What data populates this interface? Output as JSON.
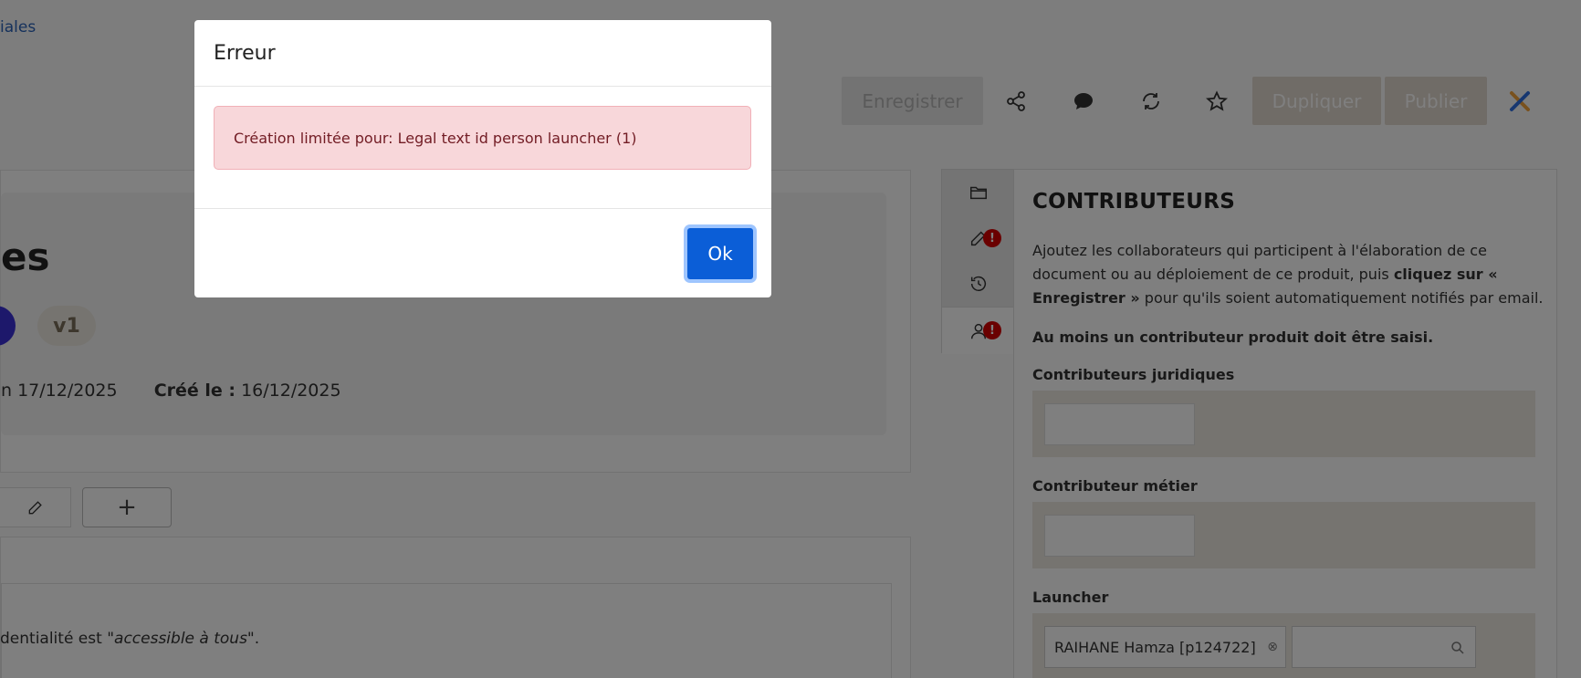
{
  "breadcrumb": {
    "fragment": "iales"
  },
  "toolbar": {
    "save_label": "Enregistrer",
    "duplicate_label": "Dupliquer",
    "publish_label": "Publier"
  },
  "card": {
    "title_fragment": "es",
    "version_badge": "v1",
    "modified_fragment": "n 17/12/2025",
    "created_label": "Créé le :",
    "created_value": "16/12/2025"
  },
  "tabs": {
    "add_label": "+"
  },
  "content": {
    "confidentiality_prefix": "dentialité est ",
    "confidentiality_value": "\"accessible à tous\"",
    "confidentiality_suffix": "."
  },
  "right_panel": {
    "title": "CONTRIBUTEURS",
    "desc_part1": "Ajoutez les collaborateurs qui participent à l'élaboration de ce document ou au déploiement de ce produit, puis ",
    "desc_bold": "cliquez sur « Enregistrer »",
    "desc_part2": " pour qu'ils soient automatiquement notifiés par email.",
    "requirement": "Au moins un contributeur produit doit être saisi.",
    "section_legal": "Contributeurs juridiques",
    "section_business": "Contributeur métier",
    "section_launcher": "Launcher",
    "launcher_tag": "RAIHANE Hamza [p124722]"
  },
  "modal": {
    "title": "Erreur",
    "message": "Création limitée pour: Legal text id person launcher (1)",
    "ok_label": "Ok"
  },
  "colors": {
    "primary": "#0b5ed7",
    "danger_bg": "#f8d7da",
    "danger_text": "#721c24",
    "alert_dot": "#d40000"
  }
}
